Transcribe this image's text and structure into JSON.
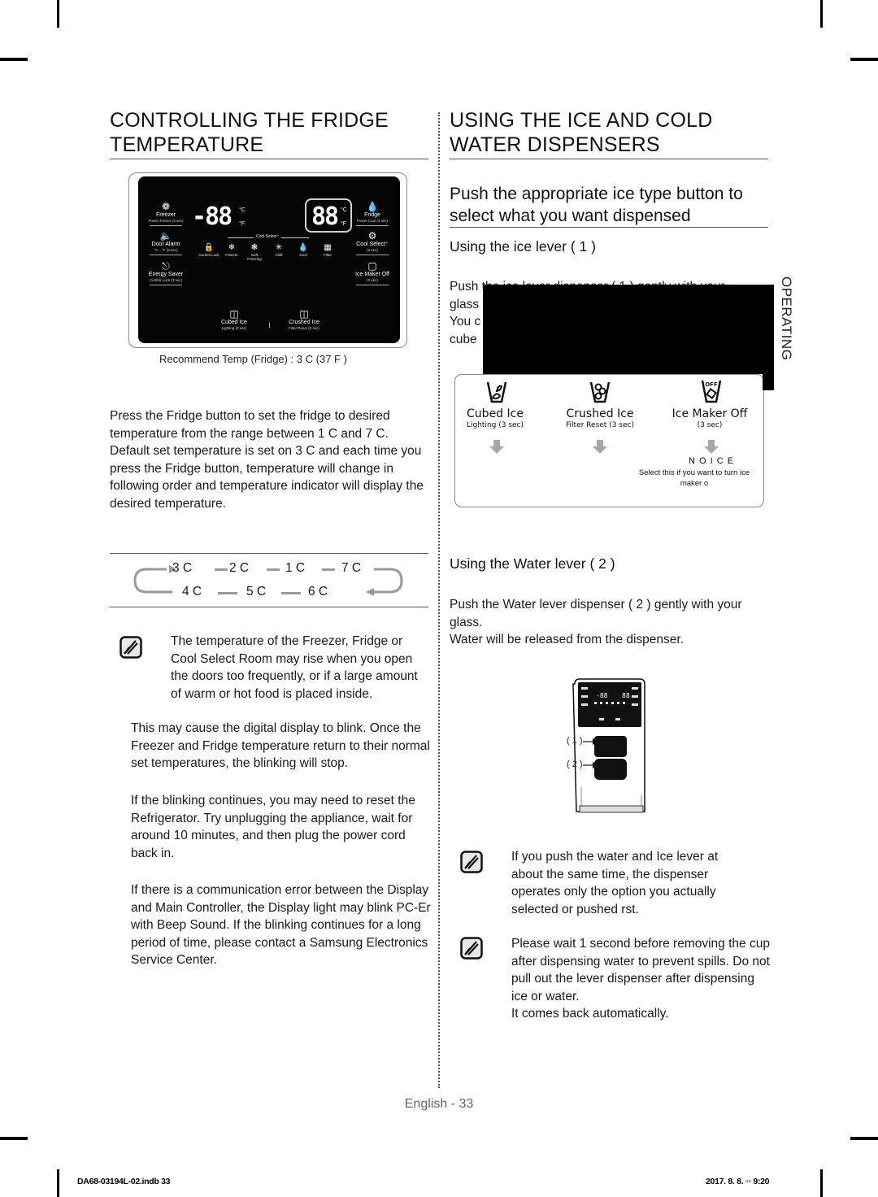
{
  "left": {
    "title_line1": "CONTROLLING THE FRIDGE",
    "title_line2": "TEMPERATURE",
    "control_panel": {
      "freezer_display": "-88",
      "fridge_display": "88",
      "unit_c": "°C",
      "unit_f": "°F",
      "cool_select_label": "Cool Select⁺",
      "left_buttons": [
        {
          "icon": "snowflake-icon",
          "label": "Freezer",
          "sub": "Power Freeze (3 sec)"
        },
        {
          "icon": "speaker-icon",
          "label": "Door Alarm",
          "sub": "°C↔°F (3 sec)"
        },
        {
          "icon": "plug-icon",
          "label": "Energy Saver",
          "sub": "Control Lock (3 sec)"
        }
      ],
      "right_buttons": [
        {
          "icon": "droplet-icon",
          "label": "Fridge",
          "sub": "Power Cool (3 sec)"
        },
        {
          "icon": "droplet-gear-icon",
          "label": "Cool Select⁺",
          "sub": "(3 sec)"
        },
        {
          "icon": "ice-maker-off-icon",
          "label": "Ice Maker Off",
          "sub": "(3 sec)"
        }
      ],
      "indicators": [
        {
          "icon": "lock-icon",
          "label": "Control Lock"
        },
        {
          "icon": "freezer-icon",
          "label": "Freezer"
        },
        {
          "icon": "soft-freezing-icon",
          "label": "Soft Freezing"
        },
        {
          "icon": "chill-icon",
          "label": "Chill"
        },
        {
          "icon": "cool-icon",
          "label": "Cool"
        },
        {
          "icon": "filter-icon",
          "label": "Filter"
        }
      ],
      "bottom_buttons": [
        {
          "icon": "cubed-ice-icon",
          "label": "Cubed Ice",
          "sub": "Lighting (3 sec)"
        },
        {
          "icon": "crushed-ice-icon",
          "label": "Crushed Ice",
          "sub": "Filter Reset (3 sec)"
        }
      ]
    },
    "recommend_caption": "Recommend Temp (Fridge) : 3   C (37   F )",
    "para1": "Press the Fridge button to set the fridge to desired temperature from the range between 1   C and 7   C.",
    "para2": "Default set temperature is set on 3   C and each time you press the Fridge button, temperature will change in following order and temperature indicator will display the desired temperature.",
    "sequence_top": [
      "3  C",
      "2  C",
      "1  C",
      "7  C"
    ],
    "sequence_bottom": [
      "4  C",
      "5  C",
      "6  C"
    ],
    "note_indented": "The temperature of the Freezer, Fridge or Cool Select Room may rise when you open the doors too frequently, or if a large amount of warm or hot food is placed inside.",
    "note_lines": [
      "This may cause the digital display to blink. Once the Freezer and Fridge temperature return to their normal set temperatures, the blinking will stop.",
      "If the blinking continues, you may need to   reset the Refrigerator. Try unplugging the appliance, wait for around 10 minutes, and then plug the power cord back in.",
      "If there is a communication error between the Display and Main Controller, the Display light may blink   PC-Er   with Beep Sound. If the blinking continues for a long period of time, please contact a Samsung Electronics Service Center."
    ]
  },
  "right": {
    "title_line1": "USING THE ICE AND COLD",
    "title_line2": "WATER DISPENSERS",
    "subheading": "Push the appropriate ice type button to select what you want dispensed",
    "ice_lever_heading": "Using the ice lever ( 1 )",
    "ice_lever_text_visible": [
      "Push",
      "glass",
      "You c",
      "cube"
    ],
    "ice_lever_text_line1_fragment": "the ice lever dispenser ( 1 ) gently with your",
    "side_tab": "OPERATING",
    "ice_options": [
      {
        "icon": "cubed-ice-icon",
        "name": "Cubed Ice",
        "sub": "Lighting (3 sec)",
        "result": ""
      },
      {
        "icon": "crushed-ice-icon",
        "name": "Crushed Ice",
        "sub": "Filter Reset (3 sec)",
        "result": ""
      },
      {
        "icon": "ice-maker-off-icon",
        "name": "Ice Maker Off",
        "sub": "(3 sec)",
        "result": "N O    I  C E",
        "result_desc": "Select this if you want to turn ice maker o"
      }
    ],
    "water_lever_heading": "Using the Water lever ( 2 )",
    "water_text": "Push the Water lever dispenser ( 2 ) gently with your glass.",
    "water_text2": "Water will be released from the dispenser.",
    "dispenser_labels": [
      "( 1 )",
      "( 2 )"
    ],
    "note1": "If you push the water and Ice lever at about the same time, the dispenser operates only the option you actually selected or pushed   rst.",
    "note2": "Please wait 1 second before removing the cup after dispensing water to prevent spills. Do not pull out the lever dispenser after dispensing ice or water.",
    "note2_extra": "It comes back automatically."
  },
  "footer": {
    "page_label": "English - 33",
    "slug_left": "DA68-03194L-02.indb   33",
    "slug_right": "2017. 8. 8.   ▫▫ 9:20"
  }
}
